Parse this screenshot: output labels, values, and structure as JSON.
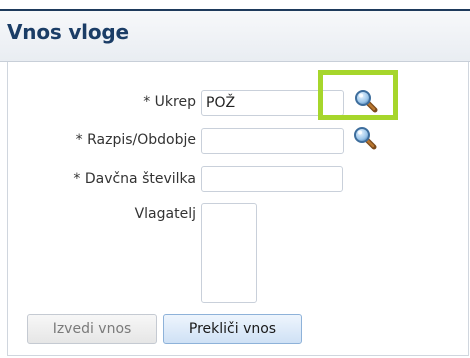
{
  "form": {
    "title": "Vnos vloge",
    "fields": {
      "ukrep": {
        "label": "* Ukrep",
        "value": "POŽ"
      },
      "razpis": {
        "label": "* Razpis/Obdobje",
        "value": ""
      },
      "davcna": {
        "label": "* Davčna številka",
        "value": ""
      },
      "vlagatelj": {
        "label": "Vlagatelj",
        "value": ""
      }
    },
    "icons": {
      "search": "magnifier-icon"
    },
    "highlight_color": "#a6d62b"
  },
  "actions": {
    "submit_label": "Izvedi vnos",
    "submit_enabled": false,
    "cancel_label": "Prekliči vnos"
  }
}
